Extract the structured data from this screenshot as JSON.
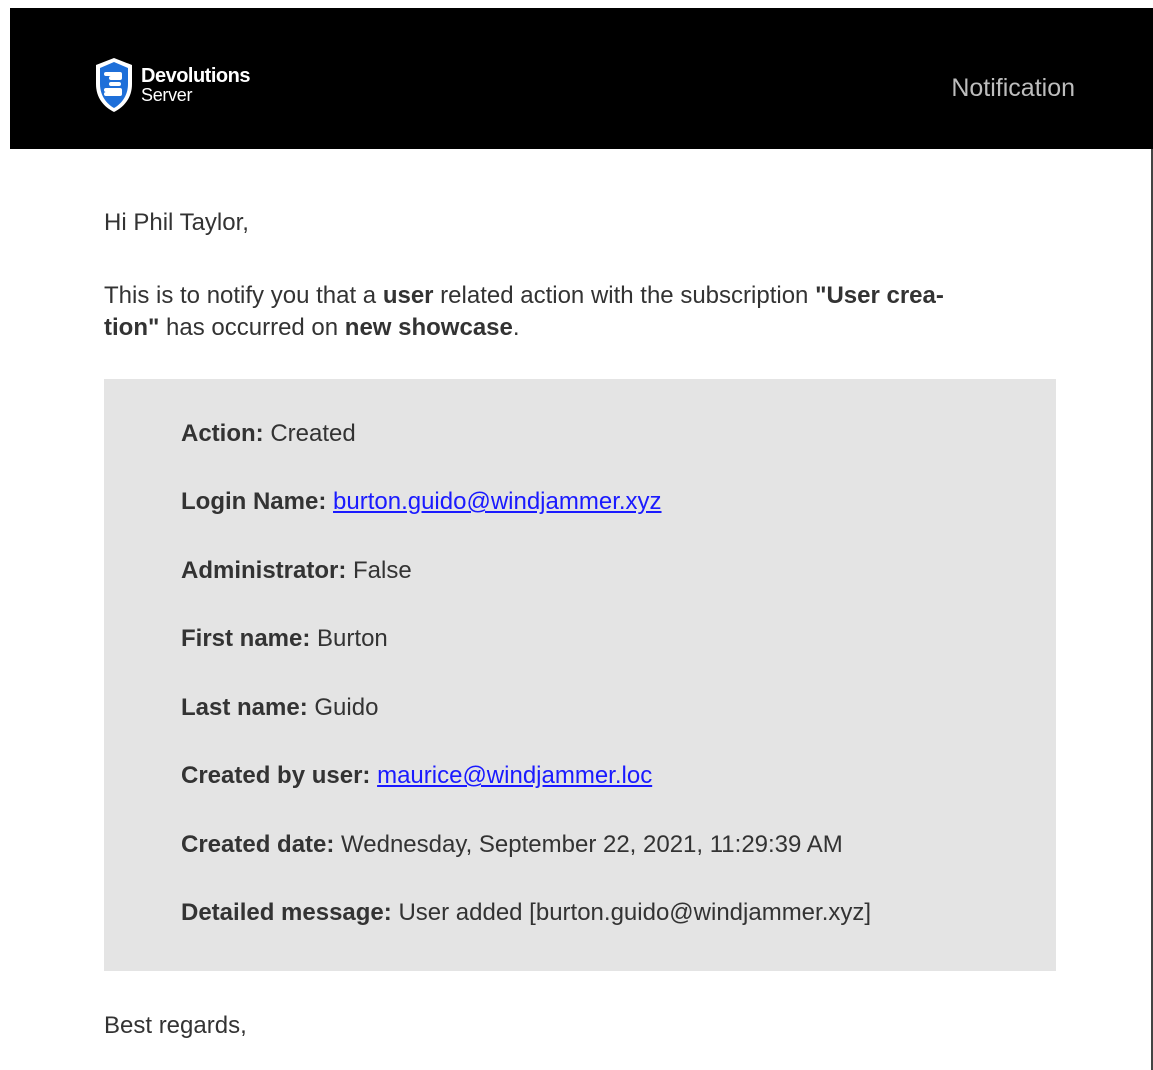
{
  "header": {
    "brand_name": "Devolutions",
    "brand_product": "Server",
    "label": "Notification",
    "logo_icon": "devolutions-shield-icon",
    "background": "#000000"
  },
  "greeting": "Hi Phil Taylor,",
  "intro": {
    "part1": "This is to notify you that a ",
    "entity": "user",
    "part2": " related action with the subscription ",
    "subscription": "\"User crea-tion\"",
    "part3": " has occurred on ",
    "target": "new showcase",
    "part4": "."
  },
  "details": [
    {
      "label": "Action:",
      "value": "Created",
      "is_link": false
    },
    {
      "label": "Login Name:",
      "value": "burton.guido@windjammer.xyz",
      "is_link": true
    },
    {
      "label": "Administrator:",
      "value": "False",
      "is_link": false
    },
    {
      "label": "First name:",
      "value": "Burton",
      "is_link": false
    },
    {
      "label": "Last name:",
      "value": "Guido",
      "is_link": false
    },
    {
      "label": "Created by user:",
      "value": "maurice@windjammer.loc",
      "is_link": true
    },
    {
      "label": "Created date:",
      "value": "Wednesday, September 22, 2021, 11:29:39 AM",
      "is_link": false
    },
    {
      "label": "Detailed message:",
      "value": "User added [burton.guido@windjammer.xyz]",
      "is_link": false
    }
  ],
  "closing": "Best regards,",
  "colors": {
    "link": "#1a1aff",
    "details_background": "#e4e4e4",
    "text": "#333333",
    "shield": "#1e6fd9"
  }
}
